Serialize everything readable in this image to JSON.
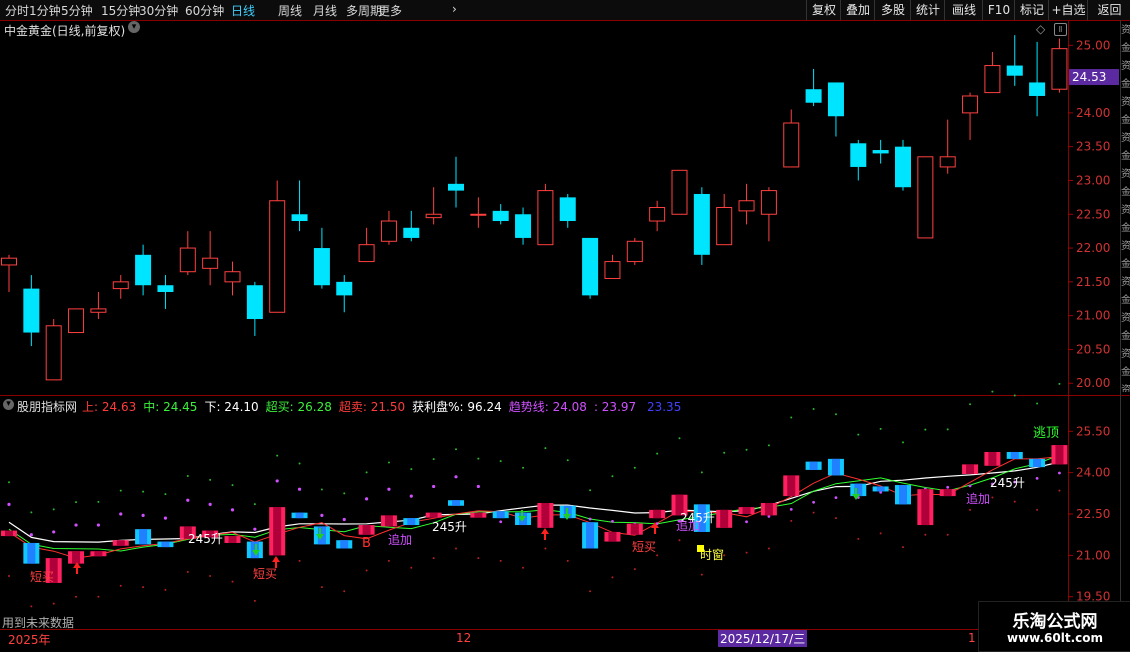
{
  "toolbar": {
    "periods": [
      "分时",
      "1分钟",
      "5分钟",
      "15分钟",
      "30分钟",
      "60分钟",
      "日线",
      "周线",
      "月线",
      "多周期",
      "更多"
    ],
    "active_period": "日线",
    "right_buttons": [
      "复权",
      "叠加",
      "多股",
      "统计",
      "画线",
      "F10",
      "标记",
      "+自选",
      "返回"
    ]
  },
  "main": {
    "title": "中金黄金(日线,前复权)",
    "price_ticks": [
      "25.00",
      "24.50",
      "24.00",
      "23.50",
      "23.00",
      "22.50",
      "22.00",
      "21.50",
      "21.00",
      "20.50",
      "20.00"
    ],
    "current_price": "24.53"
  },
  "indicator": {
    "name": "股朋指标网",
    "values": [
      {
        "label": "上:",
        "value": "24.63",
        "color": "#ff3b3b"
      },
      {
        "label": "中:",
        "value": "24.45",
        "color": "#3cf03c"
      },
      {
        "label": "下:",
        "value": "24.10",
        "color": "#ffffff"
      },
      {
        "label": "超买:",
        "value": "26.28",
        "color": "#3cf03c"
      },
      {
        "label": "超卖:",
        "value": "21.50",
        "color": "#ff3b3b"
      },
      {
        "label": "获利盘%:",
        "value": "96.24",
        "color": "#ffffff"
      },
      {
        "label": "趋势线:",
        "value": "24.08",
        "color": "#d050ff"
      },
      {
        "label": ":",
        "value": "23.97",
        "color": "#d050ff"
      },
      {
        "label": "",
        "value": "23.35",
        "color": "#4040ff"
      }
    ],
    "ticks": [
      "25.50",
      "24.00",
      "22.50",
      "21.00",
      "19.50"
    ],
    "annotations": {
      "duanmai": "短买",
      "shengjian": "245升",
      "zhuijia": "追加",
      "shichuang": "时窗",
      "taoding": "逃顶",
      "b": "B"
    },
    "footer_note": "用到未来数据"
  },
  "timeline": {
    "year_label": "2025年",
    "month_label": "12",
    "cursor_date": "2025/12/17/三",
    "tail": "1"
  },
  "watermark": {
    "title": "乐淘公式网",
    "url": "www.60lt.com"
  },
  "chart_data": {
    "type": "candlestick",
    "y_range": [
      19.9,
      25.3
    ],
    "candles": [
      {
        "o": 21.75,
        "h": 21.9,
        "l": 21.35,
        "c": 21.85
      },
      {
        "o": 21.4,
        "h": 21.6,
        "l": 20.55,
        "c": 20.75
      },
      {
        "o": 20.05,
        "h": 20.95,
        "l": 20.05,
        "c": 20.85
      },
      {
        "o": 20.75,
        "h": 21.1,
        "l": 20.75,
        "c": 21.1
      },
      {
        "o": 21.05,
        "h": 21.35,
        "l": 20.95,
        "c": 21.1
      },
      {
        "o": 21.4,
        "h": 21.6,
        "l": 21.25,
        "c": 21.5
      },
      {
        "o": 21.9,
        "h": 22.05,
        "l": 21.3,
        "c": 21.45
      },
      {
        "o": 21.45,
        "h": 21.6,
        "l": 21.1,
        "c": 21.35
      },
      {
        "o": 21.65,
        "h": 22.25,
        "l": 21.6,
        "c": 22.0
      },
      {
        "o": 21.7,
        "h": 22.25,
        "l": 21.45,
        "c": 21.85
      },
      {
        "o": 21.5,
        "h": 21.8,
        "l": 21.3,
        "c": 21.65
      },
      {
        "o": 21.45,
        "h": 21.5,
        "l": 20.7,
        "c": 20.95
      },
      {
        "o": 21.05,
        "h": 23.0,
        "l": 21.05,
        "c": 22.7
      },
      {
        "o": 22.5,
        "h": 23.0,
        "l": 22.25,
        "c": 22.4
      },
      {
        "o": 22.0,
        "h": 22.3,
        "l": 21.4,
        "c": 21.45
      },
      {
        "o": 21.5,
        "h": 21.6,
        "l": 21.05,
        "c": 21.3
      },
      {
        "o": 21.8,
        "h": 22.3,
        "l": 21.8,
        "c": 22.05
      },
      {
        "o": 22.1,
        "h": 22.55,
        "l": 22.05,
        "c": 22.4
      },
      {
        "o": 22.3,
        "h": 22.55,
        "l": 22.1,
        "c": 22.15
      },
      {
        "o": 22.45,
        "h": 22.9,
        "l": 22.35,
        "c": 22.5
      },
      {
        "o": 22.95,
        "h": 23.35,
        "l": 22.6,
        "c": 22.85
      },
      {
        "o": 22.5,
        "h": 22.75,
        "l": 22.3,
        "c": 22.5
      },
      {
        "o": 22.55,
        "h": 22.65,
        "l": 22.35,
        "c": 22.4
      },
      {
        "o": 22.5,
        "h": 22.6,
        "l": 22.05,
        "c": 22.15
      },
      {
        "o": 22.05,
        "h": 22.95,
        "l": 22.05,
        "c": 22.85
      },
      {
        "o": 22.75,
        "h": 22.8,
        "l": 22.3,
        "c": 22.4
      },
      {
        "o": 22.15,
        "h": 22.15,
        "l": 21.25,
        "c": 21.3
      },
      {
        "o": 21.55,
        "h": 21.9,
        "l": 21.55,
        "c": 21.8
      },
      {
        "o": 21.8,
        "h": 22.15,
        "l": 21.75,
        "c": 22.1
      },
      {
        "o": 22.4,
        "h": 22.7,
        "l": 22.25,
        "c": 22.6
      },
      {
        "o": 22.5,
        "h": 23.15,
        "l": 22.5,
        "c": 23.15
      },
      {
        "o": 22.8,
        "h": 22.9,
        "l": 21.75,
        "c": 21.9
      },
      {
        "o": 22.05,
        "h": 22.8,
        "l": 22.05,
        "c": 22.6
      },
      {
        "o": 22.55,
        "h": 22.95,
        "l": 22.35,
        "c": 22.7
      },
      {
        "o": 22.5,
        "h": 22.9,
        "l": 22.1,
        "c": 22.85
      },
      {
        "o": 23.2,
        "h": 24.05,
        "l": 23.2,
        "c": 23.85
      },
      {
        "o": 24.35,
        "h": 24.65,
        "l": 24.1,
        "c": 24.15
      },
      {
        "o": 24.45,
        "h": 24.45,
        "l": 23.65,
        "c": 23.95
      },
      {
        "o": 23.55,
        "h": 23.6,
        "l": 23.0,
        "c": 23.2
      },
      {
        "o": 23.45,
        "h": 23.6,
        "l": 23.25,
        "c": 23.4
      },
      {
        "o": 23.5,
        "h": 23.6,
        "l": 22.85,
        "c": 22.9
      },
      {
        "o": 22.15,
        "h": 23.35,
        "l": 22.15,
        "c": 23.35
      },
      {
        "o": 23.2,
        "h": 23.9,
        "l": 23.1,
        "c": 23.35
      },
      {
        "o": 24.0,
        "h": 24.3,
        "l": 23.6,
        "c": 24.25
      },
      {
        "o": 24.3,
        "h": 24.9,
        "l": 24.3,
        "c": 24.7
      },
      {
        "o": 24.7,
        "h": 25.15,
        "l": 24.4,
        "c": 24.55
      },
      {
        "o": 24.45,
        "h": 25.05,
        "l": 23.95,
        "c": 24.25
      },
      {
        "o": 24.35,
        "h": 25.1,
        "l": 24.3,
        "c": 24.95
      }
    ]
  }
}
